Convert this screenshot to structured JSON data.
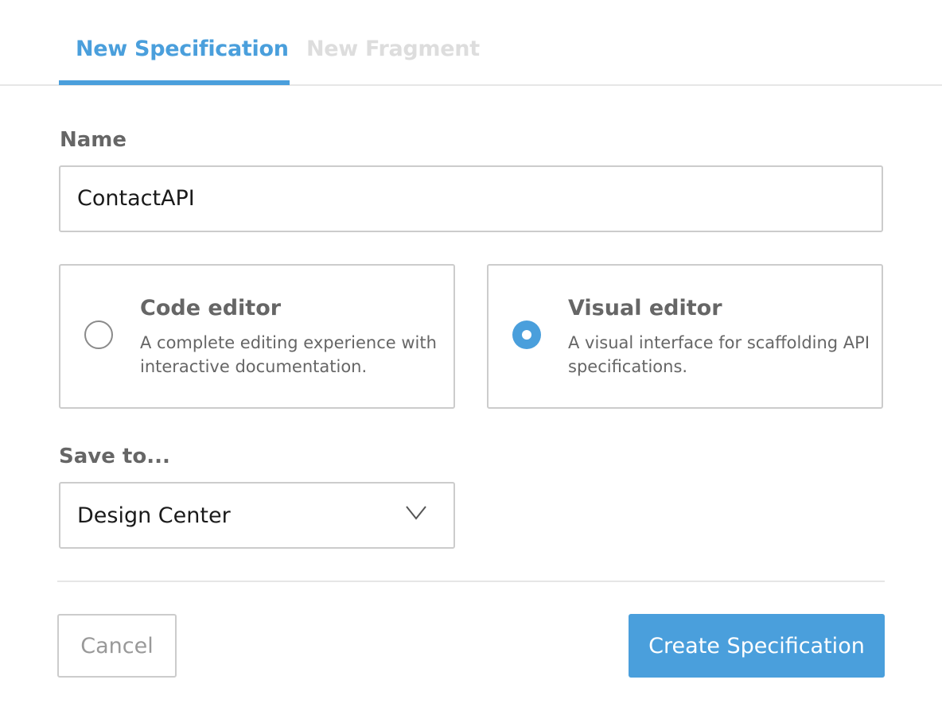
{
  "tabs": [
    {
      "label": "New Specification",
      "active": true
    },
    {
      "label": "New Fragment",
      "active": false
    }
  ],
  "name_field": {
    "label": "Name",
    "value": "ContactAPI"
  },
  "editor_options": [
    {
      "title": "Code editor",
      "description": "A complete editing experience with interactive documentation.",
      "selected": false
    },
    {
      "title": "Visual editor",
      "description": "A visual interface for scaffolding API specifications.",
      "selected": true
    }
  ],
  "save_to": {
    "label": "Save to...",
    "value": "Design Center",
    "icon": "chevron-down-icon"
  },
  "buttons": {
    "cancel": "Cancel",
    "create": "Create Specification"
  },
  "colors": {
    "accent": "#4a9fdc",
    "inactive_tab": "#dddddd",
    "border": "#cccccc"
  }
}
